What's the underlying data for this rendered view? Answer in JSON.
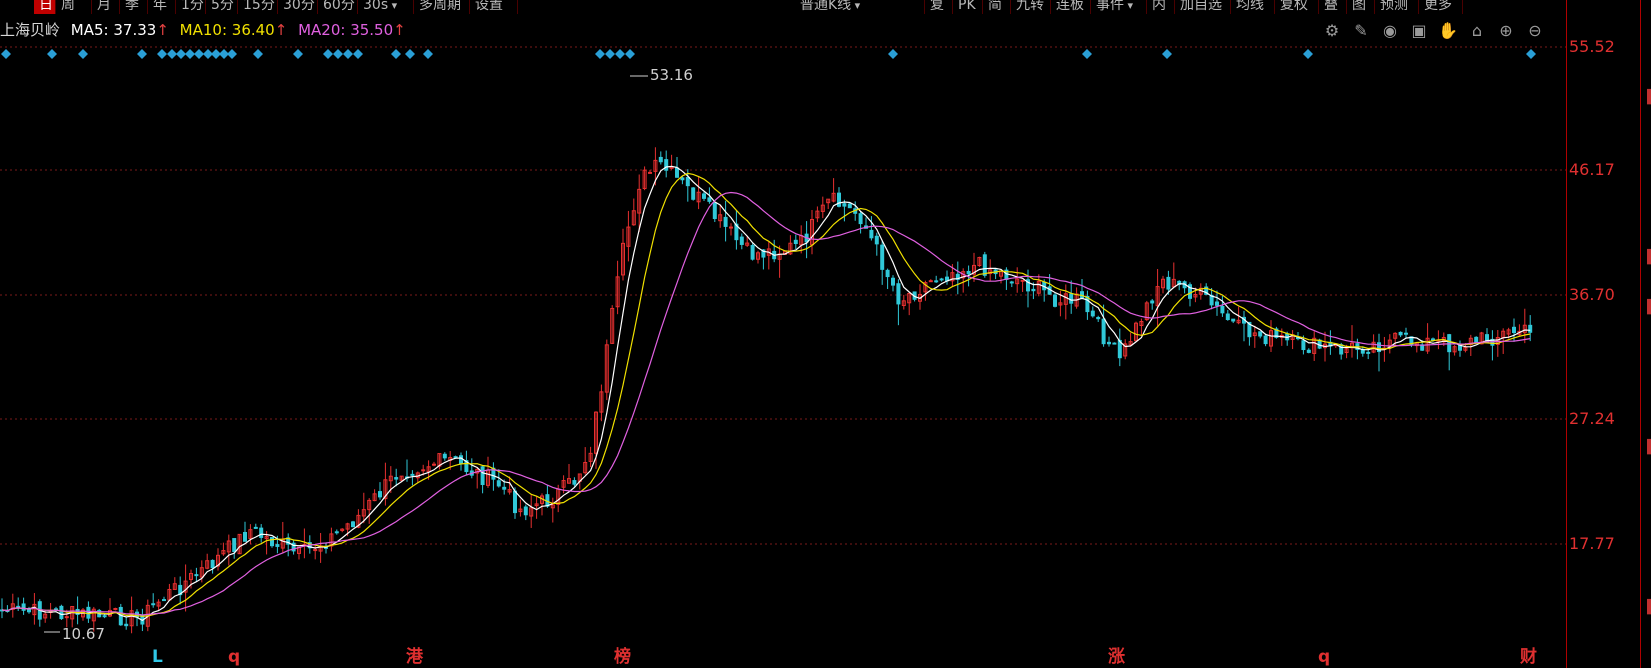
{
  "toolbar": {
    "left": [
      {
        "label": "日",
        "active": true
      },
      {
        "label": "周"
      },
      {
        "label": "月"
      },
      {
        "label": "季"
      },
      {
        "label": "年"
      },
      {
        "label": "1分"
      },
      {
        "label": "5分"
      },
      {
        "label": "15分"
      },
      {
        "label": "30分"
      },
      {
        "label": "60分"
      },
      {
        "label": "30s",
        "dropdown": true
      },
      {
        "label": "多周期"
      },
      {
        "label": "设置"
      }
    ],
    "right": [
      {
        "label": "普通K线",
        "dropdown": true
      },
      {
        "label": "复"
      },
      {
        "label": "PK"
      },
      {
        "label": "简"
      },
      {
        "label": "九转"
      },
      {
        "label": "连板"
      },
      {
        "label": "事件",
        "dropdown": true
      },
      {
        "label": "内"
      },
      {
        "label": "加自选"
      },
      {
        "label": "均线"
      },
      {
        "label": "复权"
      },
      {
        "label": "叠"
      },
      {
        "label": "图"
      },
      {
        "label": "预测"
      },
      {
        "label": "更多"
      }
    ]
  },
  "info": {
    "stock_name": "上海贝岭",
    "ma5_label": "MA5: 37.33",
    "ma10_label": "MA10: 36.40",
    "ma20_label": "MA20: 35.50",
    "arrow": "↑",
    "colors": {
      "ma5": "#ffffff",
      "ma10": "#f0e000",
      "ma20": "#e060e0",
      "up": "#e83030",
      "down": "#30c8d8",
      "grid": "#7a1a1a",
      "diamond": "#2a9fd6"
    }
  },
  "tool_icons": [
    "gear-icon",
    "pen-icon",
    "eye-icon",
    "briefcase-icon",
    "hand-icon",
    "lock-icon",
    "zoom-in-icon",
    "zoom-out-icon"
  ],
  "yaxis": {
    "labels": [
      "55.52",
      "46.17",
      "36.70",
      "27.24",
      "17.77"
    ]
  },
  "chart_data": {
    "type": "candlestick",
    "high_label": "53.16",
    "low_label": "10.67",
    "ylim": [
      10.67,
      55.52
    ],
    "grid": true,
    "event_markers": [
      {
        "label": "L",
        "color": "#30c8e8"
      },
      {
        "label": "q",
        "color": "#e03030"
      },
      {
        "label": "港",
        "color": "#e03030"
      },
      {
        "label": "榜",
        "color": "#e03030"
      },
      {
        "label": "涨",
        "color": "#e03030"
      },
      {
        "label": "q",
        "color": "#e03030"
      },
      {
        "label": "财",
        "color": "#e03030"
      }
    ]
  }
}
